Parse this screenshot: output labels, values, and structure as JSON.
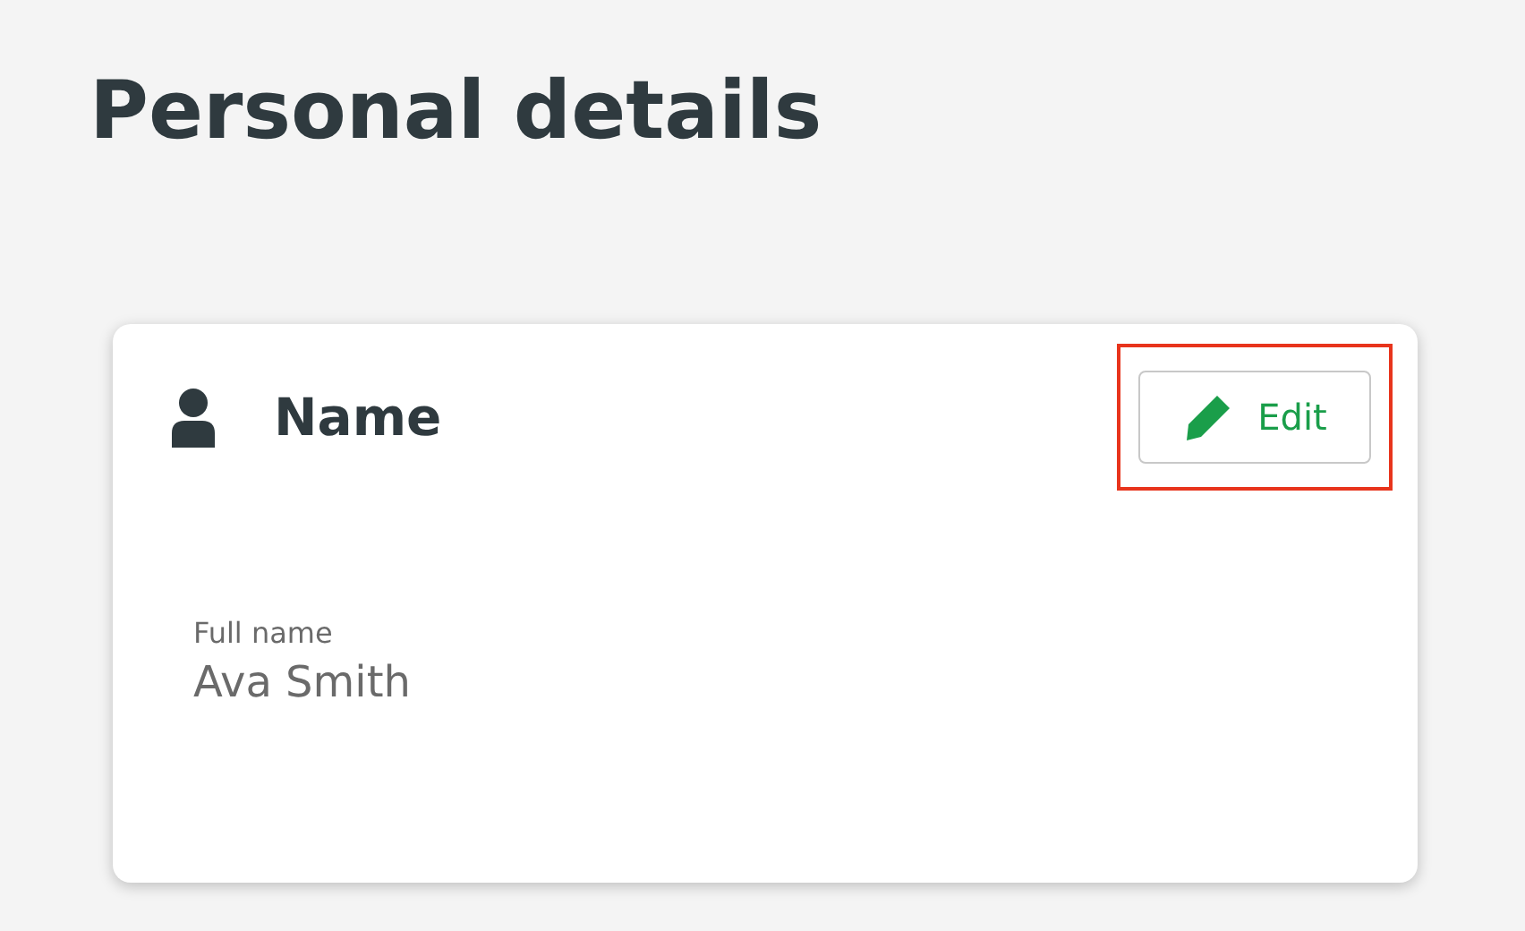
{
  "page": {
    "title": "Personal details"
  },
  "card": {
    "title": "Name",
    "edit_button": {
      "label": "Edit",
      "highlighted": true
    },
    "fields": [
      {
        "label": "Full name",
        "value": "Ava Smith"
      }
    ]
  }
}
